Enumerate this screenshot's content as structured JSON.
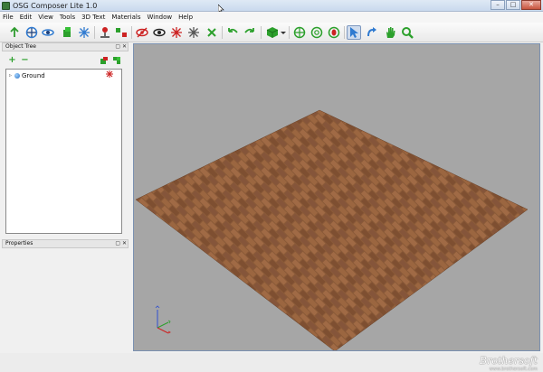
{
  "window": {
    "title": "OSG Composer Lite 1.0",
    "controls": {
      "minimize": "–",
      "maximize": "□",
      "close": "✕"
    }
  },
  "menu": [
    "File",
    "Edit",
    "View",
    "Tools",
    "3D Text",
    "Materials",
    "Window",
    "Help"
  ],
  "toolbar": {
    "buttons": [
      {
        "name": "pointer-icon",
        "color": "#2e9b2e"
      },
      {
        "name": "move-gizmo-icon",
        "color": "#2f7ad0"
      },
      {
        "name": "rotate-gizmo-icon",
        "color": "#2f7ad0"
      },
      {
        "name": "add-object-icon",
        "color": "#2ca02c"
      },
      {
        "name": "explode-icon",
        "color": "#444444"
      },
      {
        "name": "place-on-ground-icon",
        "color": "#cc2222"
      },
      {
        "name": "snap-icon",
        "color": "#2ca02c"
      },
      {
        "name": "hide-icon",
        "color": "#cc2222"
      },
      {
        "name": "show-icon",
        "color": "#222222"
      },
      {
        "name": "freeze-icon",
        "color": "#cc2222"
      },
      {
        "name": "unfreeze-icon",
        "color": "#444444"
      },
      {
        "name": "delete-icon",
        "color": "#2ca02c"
      },
      {
        "name": "undo-icon",
        "color": "#2ca02c"
      },
      {
        "name": "redo-icon",
        "color": "#2ca02c"
      },
      {
        "name": "cube-icon",
        "color": "#2ca02c"
      },
      {
        "name": "center-view-icon",
        "color": "#2ca02c"
      },
      {
        "name": "frame-all-icon",
        "color": "#2ca02c"
      },
      {
        "name": "frame-selected-icon",
        "color": "#cc2222"
      },
      {
        "name": "select-arrow-icon",
        "color": "#2f7ad0"
      },
      {
        "name": "orbit-icon",
        "color": "#2f7ad0"
      },
      {
        "name": "pan-hand-icon",
        "color": "#2ca02c"
      },
      {
        "name": "zoom-icon",
        "color": "#2ca02c"
      }
    ]
  },
  "object_tree": {
    "title": "Object Tree",
    "add_label": "+",
    "remove_label": "−",
    "items": [
      {
        "label": "Ground",
        "expander": "▹"
      }
    ]
  },
  "properties": {
    "title": "Properties"
  },
  "panel_buttons": "▢ ✕",
  "watermark": {
    "text": "Brothersoft",
    "sub": "www.brothersoft.com"
  },
  "colors": {
    "accent": "#2f7ad0",
    "floor": "#8a5a38"
  }
}
